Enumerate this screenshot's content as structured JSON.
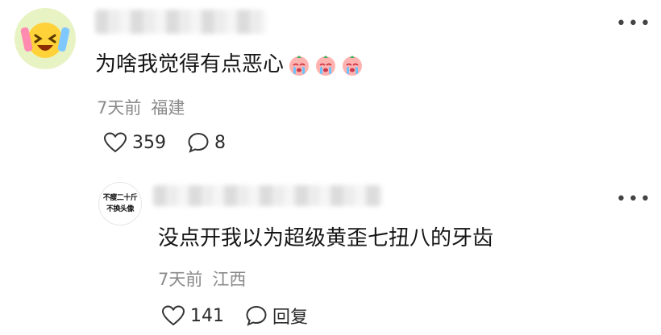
{
  "comment": {
    "text": "为啥我觉得有点恶心",
    "emoji_count": 3,
    "emoji_name": "crying-face-emoji",
    "time": "7天前",
    "location": "福建",
    "likes": "359",
    "replies": "8"
  },
  "reply": {
    "avatar_line1": "不瘦二十斤",
    "avatar_line2": "不换头像",
    "text": "没点开我以为超级黄歪七扭八的牙齿",
    "time": "7天前",
    "location": "江西",
    "likes": "141",
    "reply_label": "回复"
  },
  "icons": {
    "like": "heart-outline-icon",
    "comment": "speech-bubble-icon",
    "more": "more-dots-icon"
  }
}
